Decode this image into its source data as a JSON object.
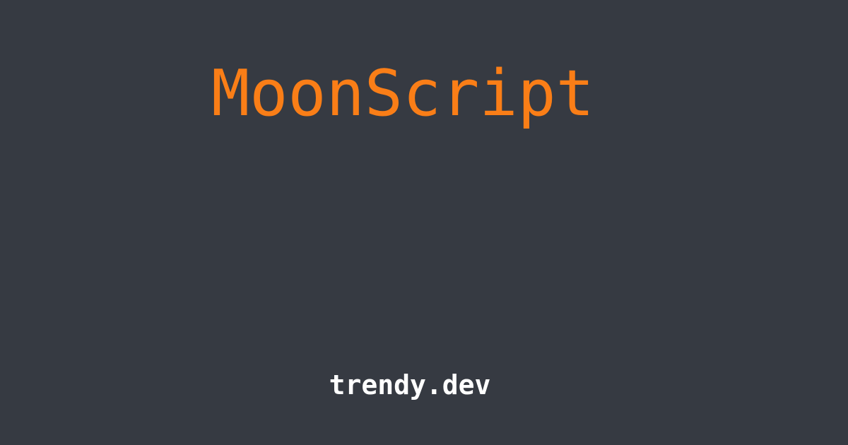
{
  "card": {
    "title": "MoonScript",
    "site": "trendy.dev"
  },
  "colors": {
    "background": "#363a42",
    "title": "#fa7e17",
    "site": "#ffffff"
  }
}
